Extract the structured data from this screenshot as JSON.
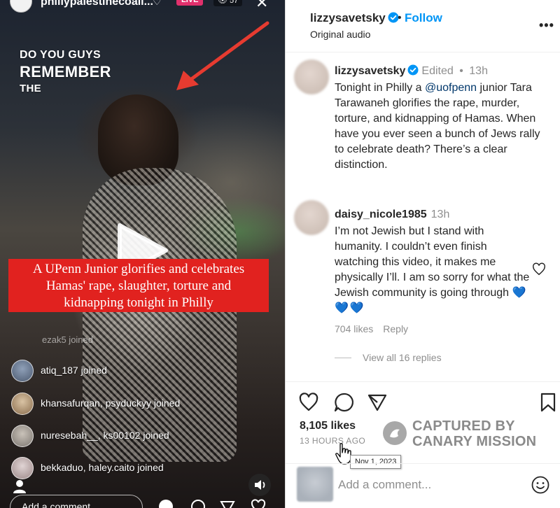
{
  "video": {
    "handle": "phillypalestinecoali...",
    "live_label": "LIVE",
    "viewer_count": "57",
    "overlay_lines": [
      "DO YOU GUYS",
      "REMEMBER",
      "THE"
    ],
    "caption_lines": [
      "A UPenn Junior glorifies and celebrates",
      "Hamas' rape, slaughter, torture and",
      "kidnapping tonight in Philly"
    ],
    "ghost_join": "ezak5 joined",
    "joins": [
      "atiq_187 joined",
      "khansafurqan, psyduckyy joined",
      "nuresebah__, ks00102 joined",
      "bekkaduo, haley.caito joined"
    ],
    "add_comment_placeholder": "Add a comment..."
  },
  "post": {
    "header": {
      "username": "lizzysavetsky",
      "follow_label": "Follow",
      "subtitle": "Original audio"
    },
    "caption": {
      "username": "lizzysavetsky",
      "edited_label": "Edited",
      "time": "13h",
      "text_before_mention": "Tonight in Philly a ",
      "mention": "@uofpenn",
      "text_after_mention": " junior Tara Tarawaneh glorifies the rape, murder, torture, and kidnapping of Hamas. When have you ever seen a bunch of Jews rally to celebrate death? There’s a clear distinction."
    },
    "comment": {
      "username": "daisy_nicole1985",
      "time": "13h",
      "text": "I’m not Jewish but I stand with humanity. I couldn’t even finish watching this video, it makes me physically I’ll. I am so sorry for what the Jewish community is going through ",
      "hearts": "💙💙💙",
      "likes": "704 likes",
      "reply_label": "Reply",
      "view_replies": "View all 16 replies"
    },
    "likes": "8,105 likes",
    "time_ago": "13 HOURS AGO",
    "tooltip_date": "Nov 1, 2023",
    "comment_placeholder": "Add a comment..."
  },
  "watermark": {
    "line1": "CAPTURED BY",
    "line2": "CANARY MISSION"
  }
}
